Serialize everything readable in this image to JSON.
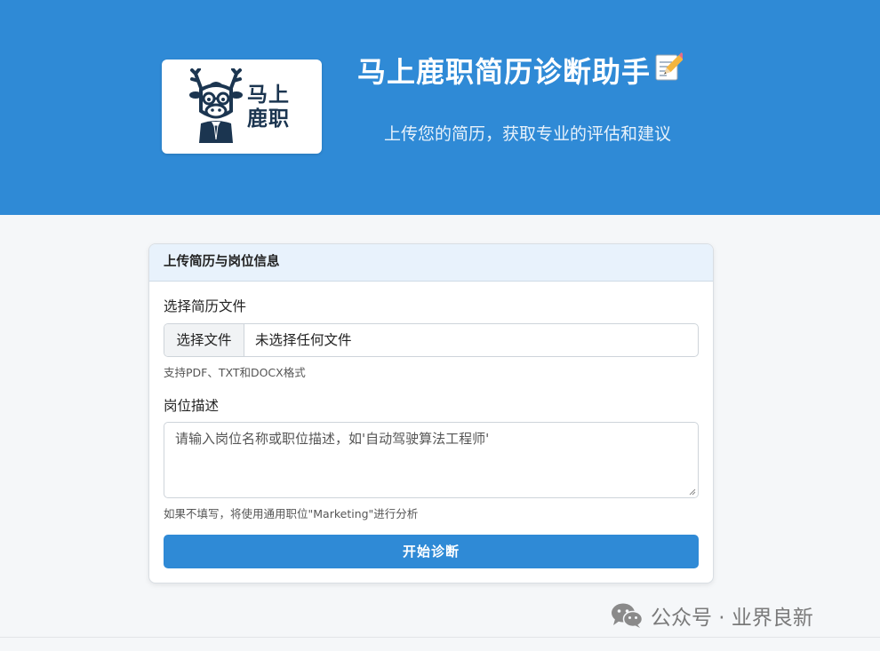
{
  "header": {
    "logo_line1": "马上",
    "logo_line2": "鹿职",
    "title": "马上鹿职简历诊断助手",
    "title_icon": "memo-pencil-icon",
    "subtitle": "上传您的简历，获取专业的评估和建议"
  },
  "form": {
    "card_title": "上传简历与岗位信息",
    "resume_label": "选择简历文件",
    "file_button": "选择文件",
    "file_status": "未选择任何文件",
    "file_hint": "支持PDF、TXT和DOCX格式",
    "job_label": "岗位描述",
    "job_placeholder": "请输入岗位名称或职位描述，如'自动驾驶算法工程师'",
    "job_hint": "如果不填写，将使用通用职位\"Marketing\"进行分析",
    "submit_label": "开始诊断"
  },
  "watermark": {
    "text": "公众号 · 业界良新",
    "icon": "wechat-icon"
  },
  "colors": {
    "header_bg": "#2f8ad6",
    "button_bg": "#2f8ad6",
    "card_header_bg": "#e8f2fc",
    "page_bg": "#f5f7f9"
  }
}
